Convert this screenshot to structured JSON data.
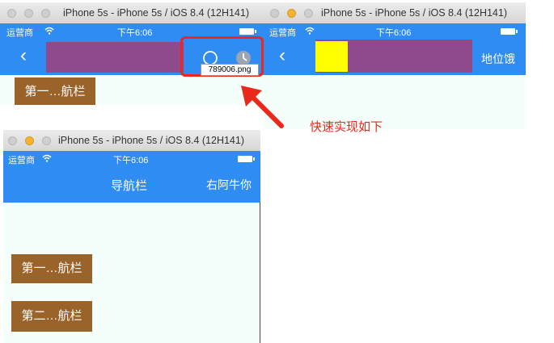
{
  "windows": {
    "top_left": {
      "title": "iPhone 5s - iPhone 5s / iOS 8.4 (12H141)",
      "carrier": "运营商",
      "time": "下午6:06",
      "back_glyph": "‹",
      "button_label": "第一…航栏",
      "file_tooltip": "789006.png"
    },
    "top_right": {
      "title": "iPhone 5s - iPhone 5s / iOS 8.4 (12H141)",
      "carrier": "运营商",
      "time": "下午6:06",
      "back_glyph": "‹",
      "nav_right_text": "地位饿"
    },
    "bottom_left": {
      "title": "iPhone 5s - iPhone 5s / iOS 8.4 (12H141)",
      "carrier": "运营商",
      "time": "下午6:06",
      "nav_title": "导航栏",
      "nav_right_text": "右阿牛你",
      "button1_label": "第一…航栏",
      "button2_label": "第二…航栏"
    }
  },
  "annotation": {
    "text": "快速实现如下",
    "color": "#e8291c"
  },
  "colors": {
    "nav_blue": "#2f8cf2",
    "purple_bar": "#8e4a8c",
    "yellow_square": "#ffff00",
    "brown_button": "#9a632a",
    "content_bg": "#f4fffb",
    "highlight_red": "#e8291c"
  },
  "icons": [
    "wifi-icon",
    "battery-icon",
    "back-chevron-icon",
    "circle-icon",
    "clock-icon",
    "arrow-icon"
  ]
}
